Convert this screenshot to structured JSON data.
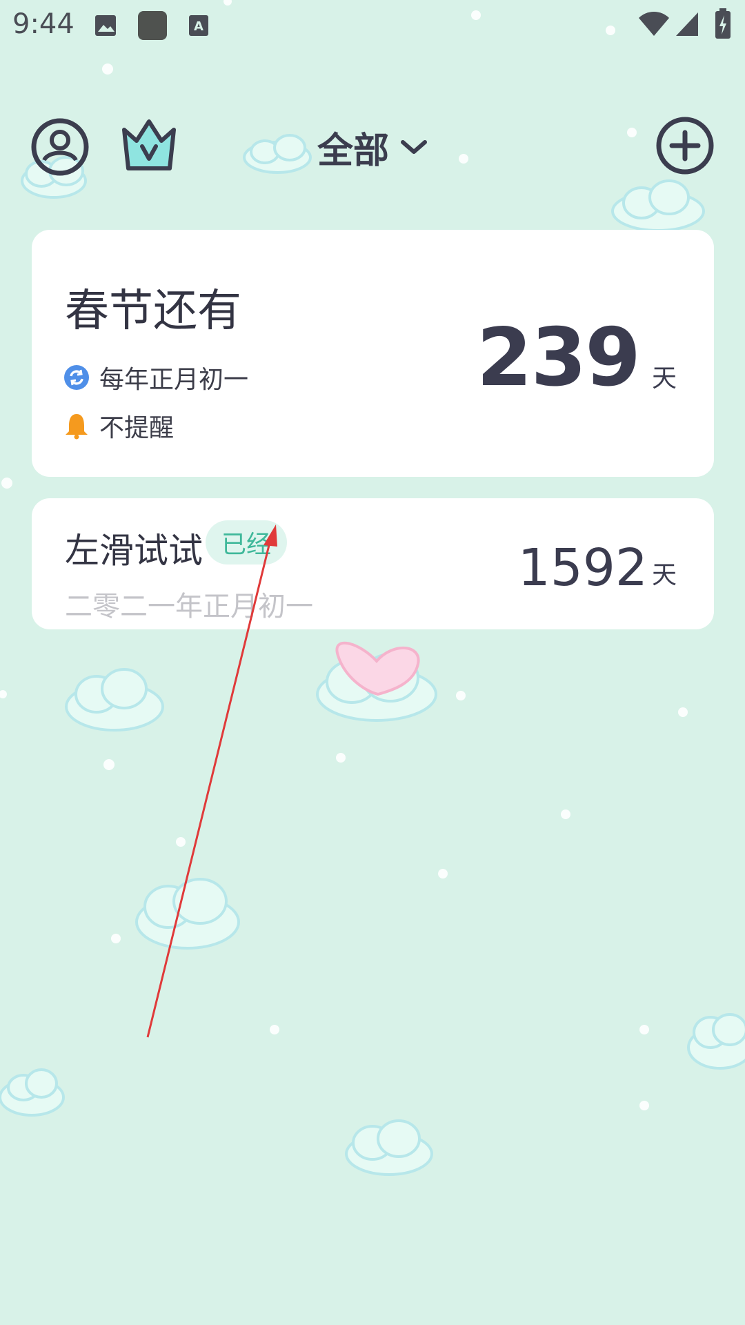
{
  "status_bar": {
    "time": "9:44",
    "icons": [
      "image-icon",
      "app-icon",
      "text-icon",
      "wifi-icon",
      "signal-icon",
      "battery-icon"
    ]
  },
  "header": {
    "profile_icon": "profile-icon",
    "vip_icon": "crown-icon",
    "filter_label": "全部",
    "filter_icon": "chevron-down-icon",
    "add_icon": "plus-icon"
  },
  "main_card": {
    "title": "春节还有",
    "repeat_text": "每年正月初一",
    "reminder_text": "不提醒",
    "days": "239",
    "unit": "天"
  },
  "second_card": {
    "title": "左滑试试",
    "badge": "已经",
    "date": "二零二一年正月初一",
    "days": "1592",
    "unit": "天"
  },
  "colors": {
    "background": "#d8f2e8",
    "card": "#ffffff",
    "accent_green": "#3fb89a",
    "repeat_blue": "#4f8fe8",
    "bell_orange": "#f59a1e",
    "arrow_red": "#e03a3a"
  }
}
